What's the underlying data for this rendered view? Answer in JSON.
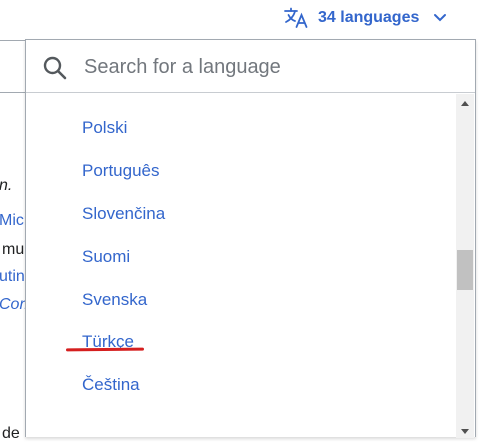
{
  "language_button": {
    "label": "34 languages",
    "icon": "translate-icon",
    "chevron": "chevron-down-icon"
  },
  "background_text": {
    "frag1": "n.",
    "frag2": "Micr",
    "frag3": "mu",
    "frag4": "utin",
    "frag5": "Com",
    "frag6": "de"
  },
  "search": {
    "placeholder": "Search for a language",
    "value": ""
  },
  "languages": [
    {
      "label": "Polski"
    },
    {
      "label": "Português"
    },
    {
      "label": "Slovenčina"
    },
    {
      "label": "Suomi"
    },
    {
      "label": "Svenska"
    },
    {
      "label": "Türkçe",
      "highlighted": true
    },
    {
      "label": "Čeština"
    }
  ],
  "colors": {
    "link": "#3366cc",
    "annotation": "#d51f1f",
    "border": "#a2a9b1"
  }
}
